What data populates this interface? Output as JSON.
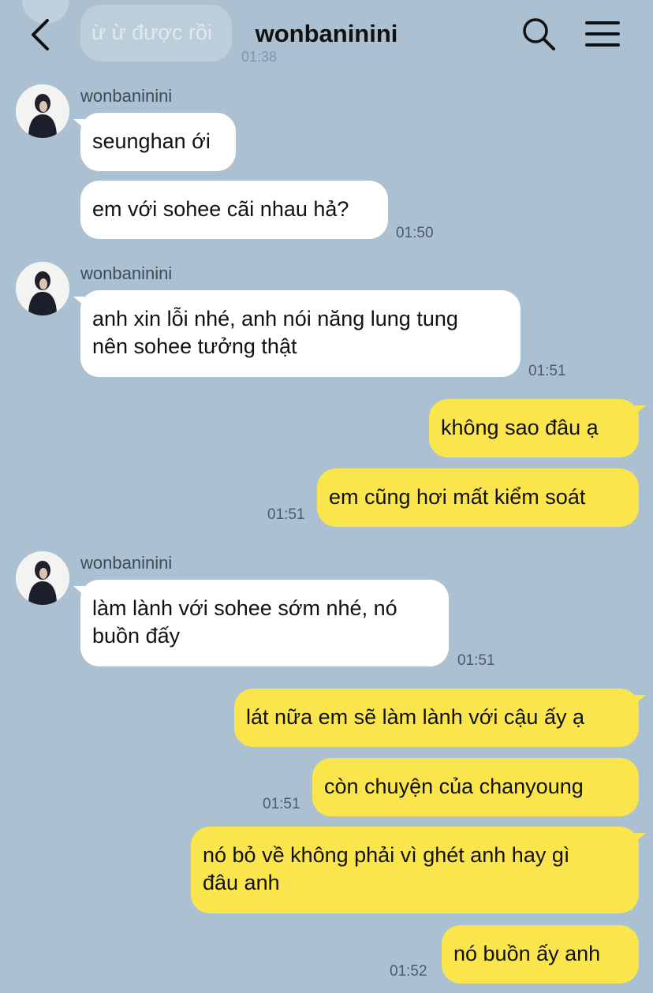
{
  "header": {
    "title": "wonbaninini",
    "back_icon": "chevron-left-icon",
    "search_icon": "search-icon",
    "menu_icon": "hamburger-menu-icon",
    "previous_message": {
      "text": "ừ ừ được rồi",
      "time": "01:38"
    }
  },
  "colors": {
    "background": "#abc1d1",
    "incoming_bubble": "#ffffff",
    "outgoing_bubble": "#fae64c"
  },
  "messages": [
    {
      "sender": "wonbaninini",
      "incoming": [
        {
          "text": "seunghan ới"
        },
        {
          "text": "em với sohee cãi nhau hả?"
        }
      ],
      "time": "01:50"
    },
    {
      "sender": "wonbaninini",
      "incoming": [
        {
          "line1": "anh xin lỗi nhé, anh nói năng lung tung",
          "line2": "nên sohee tưởng thật"
        }
      ],
      "time": "01:51"
    },
    {
      "outgoing": [
        {
          "text": "không sao đâu ạ"
        },
        {
          "text": "em cũng hơi mất kiểm soát"
        }
      ],
      "time": "01:51"
    },
    {
      "sender": "wonbaninini",
      "incoming": [
        {
          "line1": "làm lành với sohee sớm nhé, nó",
          "line2": "buồn đấy"
        }
      ],
      "time": "01:51"
    },
    {
      "outgoing": [
        {
          "text": "lát nữa em sẽ làm lành với cậu ấy ạ"
        },
        {
          "text": "còn chuyện của chanyoung"
        }
      ],
      "time": "01:51"
    },
    {
      "outgoing": [
        {
          "line1": "nó bỏ về không phải vì ghét anh hay gì",
          "line2": "đâu anh"
        },
        {
          "text": "nó buồn ấy anh"
        }
      ],
      "time": "01:52"
    }
  ]
}
